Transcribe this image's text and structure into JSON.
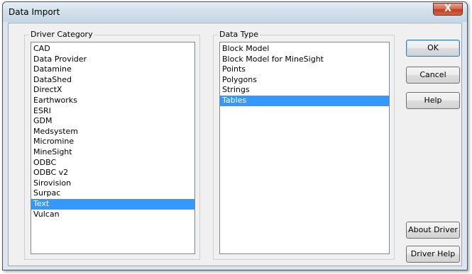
{
  "window": {
    "title": "Data Import",
    "close_label": "X"
  },
  "driver_category": {
    "label": "Driver Category",
    "items": [
      "CAD",
      "Data Provider",
      "Datamine",
      "DataShed",
      "DirectX",
      "Earthworks",
      "ESRI",
      "GDM",
      "Medsystem",
      "Micromine",
      "MineSight",
      "ODBC",
      "ODBC v2",
      "Sirovision",
      "Surpac",
      "Text",
      "Vulcan"
    ],
    "selected": "Text"
  },
  "data_type": {
    "label": "Data Type",
    "items": [
      "Block Model",
      "Block Model for MineSight",
      "Points",
      "Polygons",
      "Strings",
      "Tables"
    ],
    "selected": "Tables"
  },
  "buttons": {
    "ok": "OK",
    "cancel": "Cancel",
    "help": "Help",
    "about_driver": "About Driver",
    "driver_help": "Driver Help"
  }
}
